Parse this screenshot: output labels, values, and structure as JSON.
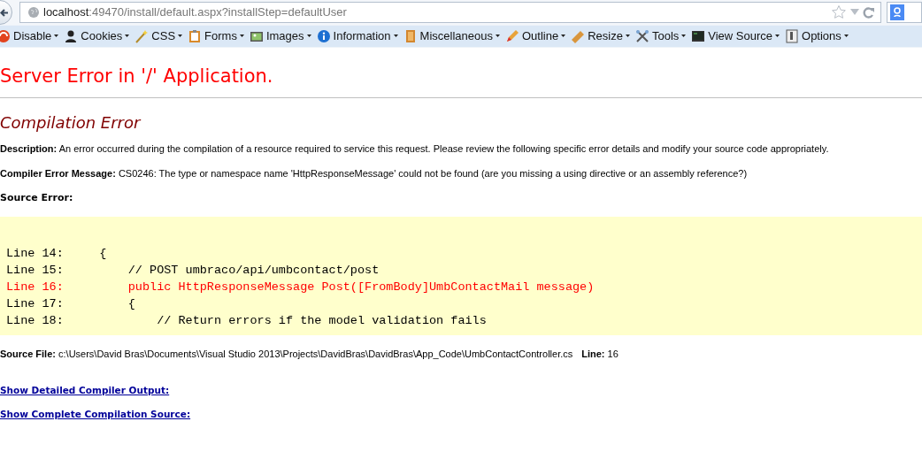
{
  "address_bar": {
    "host": "localhost",
    "path": ":49470/install/default.aspx?installStep=defaultUser"
  },
  "toolbar": [
    {
      "label": "Disable"
    },
    {
      "label": "Cookies"
    },
    {
      "label": "CSS"
    },
    {
      "label": "Forms"
    },
    {
      "label": "Images"
    },
    {
      "label": "Information"
    },
    {
      "label": "Miscellaneous"
    },
    {
      "label": "Outline"
    },
    {
      "label": "Resize"
    },
    {
      "label": "Tools"
    },
    {
      "label": "View Source"
    },
    {
      "label": "Options"
    }
  ],
  "title": "Server Error in '/' Application.",
  "subtitle": "Compilation Error",
  "description": "**Description:** An error occurred during the compilation of a resource required to service this request. Please review the following specific error details and modify your source code appropriately.",
  "compiler_message": "**Compiler Error Message:** CS0246: The type or namespace name 'HttpResponseMessage' could not be found (are you missing a using directive or an assembly reference?)",
  "source_error_label": "Source Error:",
  "code_lines": [
    {
      "text": "Line 14:     {",
      "error": false
    },
    {
      "text": "Line 15:         // POST umbraco/api/umbcontact/post",
      "error": false
    },
    {
      "text": "Line 16:         public HttpResponseMessage Post([FromBody]UmbContactMail message)",
      "error": true
    },
    {
      "text": "Line 17:         {",
      "error": false
    },
    {
      "text": "Line 18:             // Return errors if the model validation fails",
      "error": false
    }
  ],
  "source_file": "**Source File:** c:\\Users\\David Bras\\Documents\\Visual Studio 2013\\Projects\\DavidBras\\DavidBras\\App_Code\\UmbContactController.cs",
  "source_line": "**Line:** 16",
  "links": [
    "Show Detailed Compiler Output:",
    "Show Complete Compilation Source:"
  ]
}
